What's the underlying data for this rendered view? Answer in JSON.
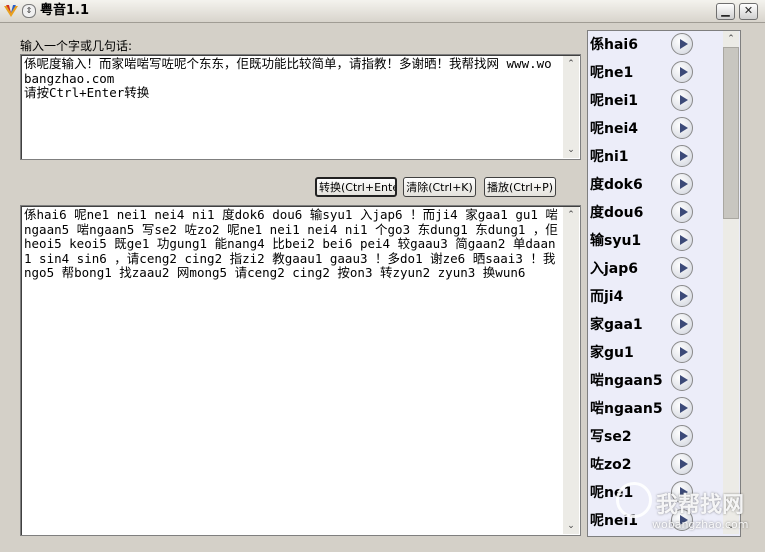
{
  "window": {
    "title": "粤音1.1",
    "minimize_icon": "minimize-icon",
    "close_icon": "close-icon"
  },
  "input": {
    "label": "输入一个字或几句话:",
    "value": "係呢度输入！而家啱啱写咗呢个东东，佢既功能比较简单，请指教！多谢晒！我帮找网 www.wobangzhao.com\n请按Ctrl+Enter转换\n"
  },
  "buttons": {
    "convert": "转换(Ctrl+Enter)",
    "clear": "清除(Ctrl+K)",
    "play": "播放(Ctrl+P)"
  },
  "output": {
    "value": "係hai6 呢ne1 nei1 nei4 ni1 度dok6 dou6 输syu1 入jap6 ！而ji4 家gaa1 gu1 啱ngaan5 啱ngaan5 写se2 咗zo2 呢ne1 nei1 nei4 ni1 个go3 东dung1 东dung1 ，佢heoi5 keoi5 既ge1 功gung1 能nang4 比bei2 bei6 pei4 较gaau3 简gaan2 单daan1 sin4 sin6 ，请ceng2 cing2 指zi2 教gaau1 gaau3 ！多do1 谢ze6 晒saai3 ！我ngo5 帮bong1 找zaau2 网mong5 请ceng2 cing2 按on3 转zyun2 zyun3 换wun6"
  },
  "syllables": [
    {
      "label": "係hai6"
    },
    {
      "label": "呢ne1"
    },
    {
      "label": "呢nei1"
    },
    {
      "label": "呢nei4"
    },
    {
      "label": "呢ni1"
    },
    {
      "label": "度dok6"
    },
    {
      "label": "度dou6"
    },
    {
      "label": "输syu1"
    },
    {
      "label": "入jap6"
    },
    {
      "label": "而ji4"
    },
    {
      "label": "家gaa1"
    },
    {
      "label": "家gu1"
    },
    {
      "label": "啱ngaan5"
    },
    {
      "label": "啱ngaan5"
    },
    {
      "label": "写se2"
    },
    {
      "label": "咗zo2"
    },
    {
      "label": "呢ne1"
    },
    {
      "label": "呢nei1"
    }
  ],
  "watermark": {
    "text": "我帮找网",
    "url": "wobangzhao.com"
  }
}
